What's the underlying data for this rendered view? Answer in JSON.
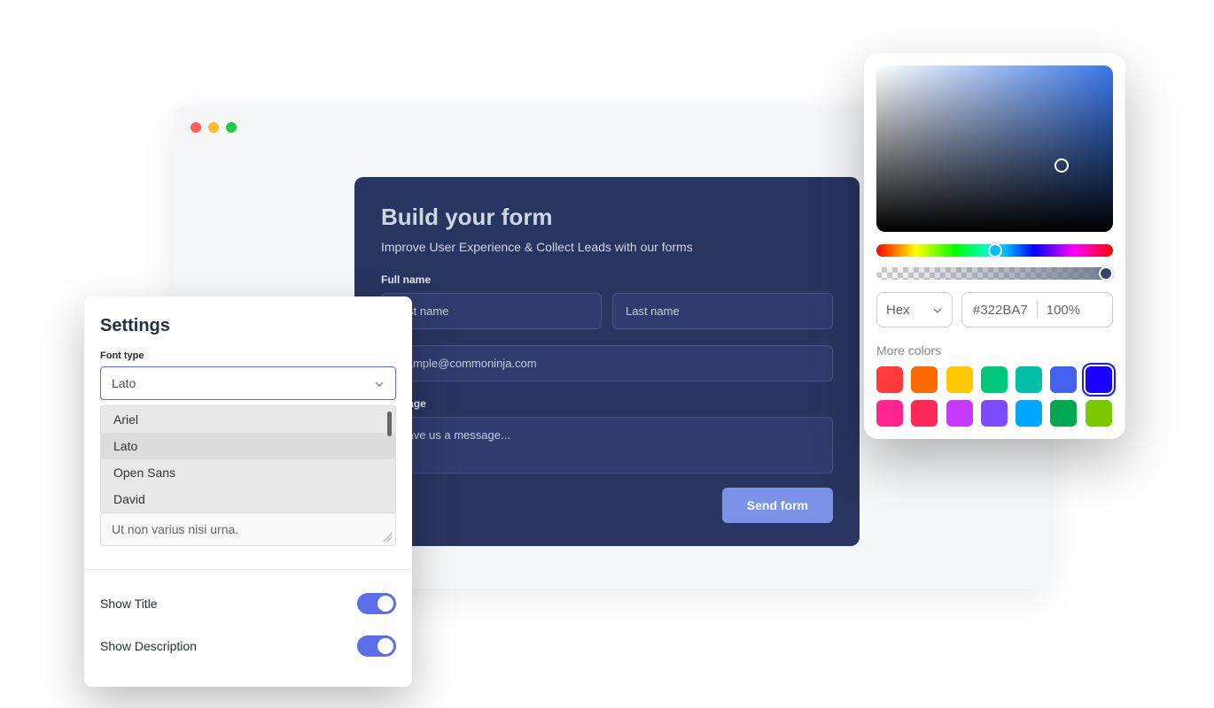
{
  "form": {
    "title": "Build your form",
    "subtitle": "Improve User Experience & Collect Leads with our forms",
    "fullname_label": "Full name",
    "firstname_placeholder": "First name",
    "lastname_placeholder": "Last name",
    "email_placeholder": "example@commoninja.com",
    "message_label": "Message",
    "message_placeholder": "Leave us a message...",
    "submit_label": "Send form"
  },
  "settings": {
    "title": "Settings",
    "font_type_label": "Font type",
    "font_selected": "Lato",
    "font_options": [
      "Ariel",
      "Lato",
      "Open Sans",
      "David"
    ],
    "textarea_text": "Ut non varius nisi urna.",
    "show_title_label": "Show Title",
    "show_description_label": "Show Description"
  },
  "colorpicker": {
    "format_label": "Hex",
    "hex_value": "#322BA7",
    "opacity": "100%",
    "more_colors_label": "More colors",
    "swatches": [
      {
        "color": "#ff3b3b",
        "selected": false
      },
      {
        "color": "#ff6a00",
        "selected": false
      },
      {
        "color": "#ffc800",
        "selected": false
      },
      {
        "color": "#00c97c",
        "selected": false
      },
      {
        "color": "#00bfa6",
        "selected": false
      },
      {
        "color": "#4361ee",
        "selected": false
      },
      {
        "color": "#1a00ff",
        "selected": true
      },
      {
        "color": "#ff2590",
        "selected": false
      },
      {
        "color": "#ff2957",
        "selected": false
      },
      {
        "color": "#c63cff",
        "selected": false
      },
      {
        "color": "#7c4dff",
        "selected": false
      },
      {
        "color": "#00a7ff",
        "selected": false
      },
      {
        "color": "#00a851",
        "selected": false
      },
      {
        "color": "#7ac800",
        "selected": false
      }
    ]
  }
}
